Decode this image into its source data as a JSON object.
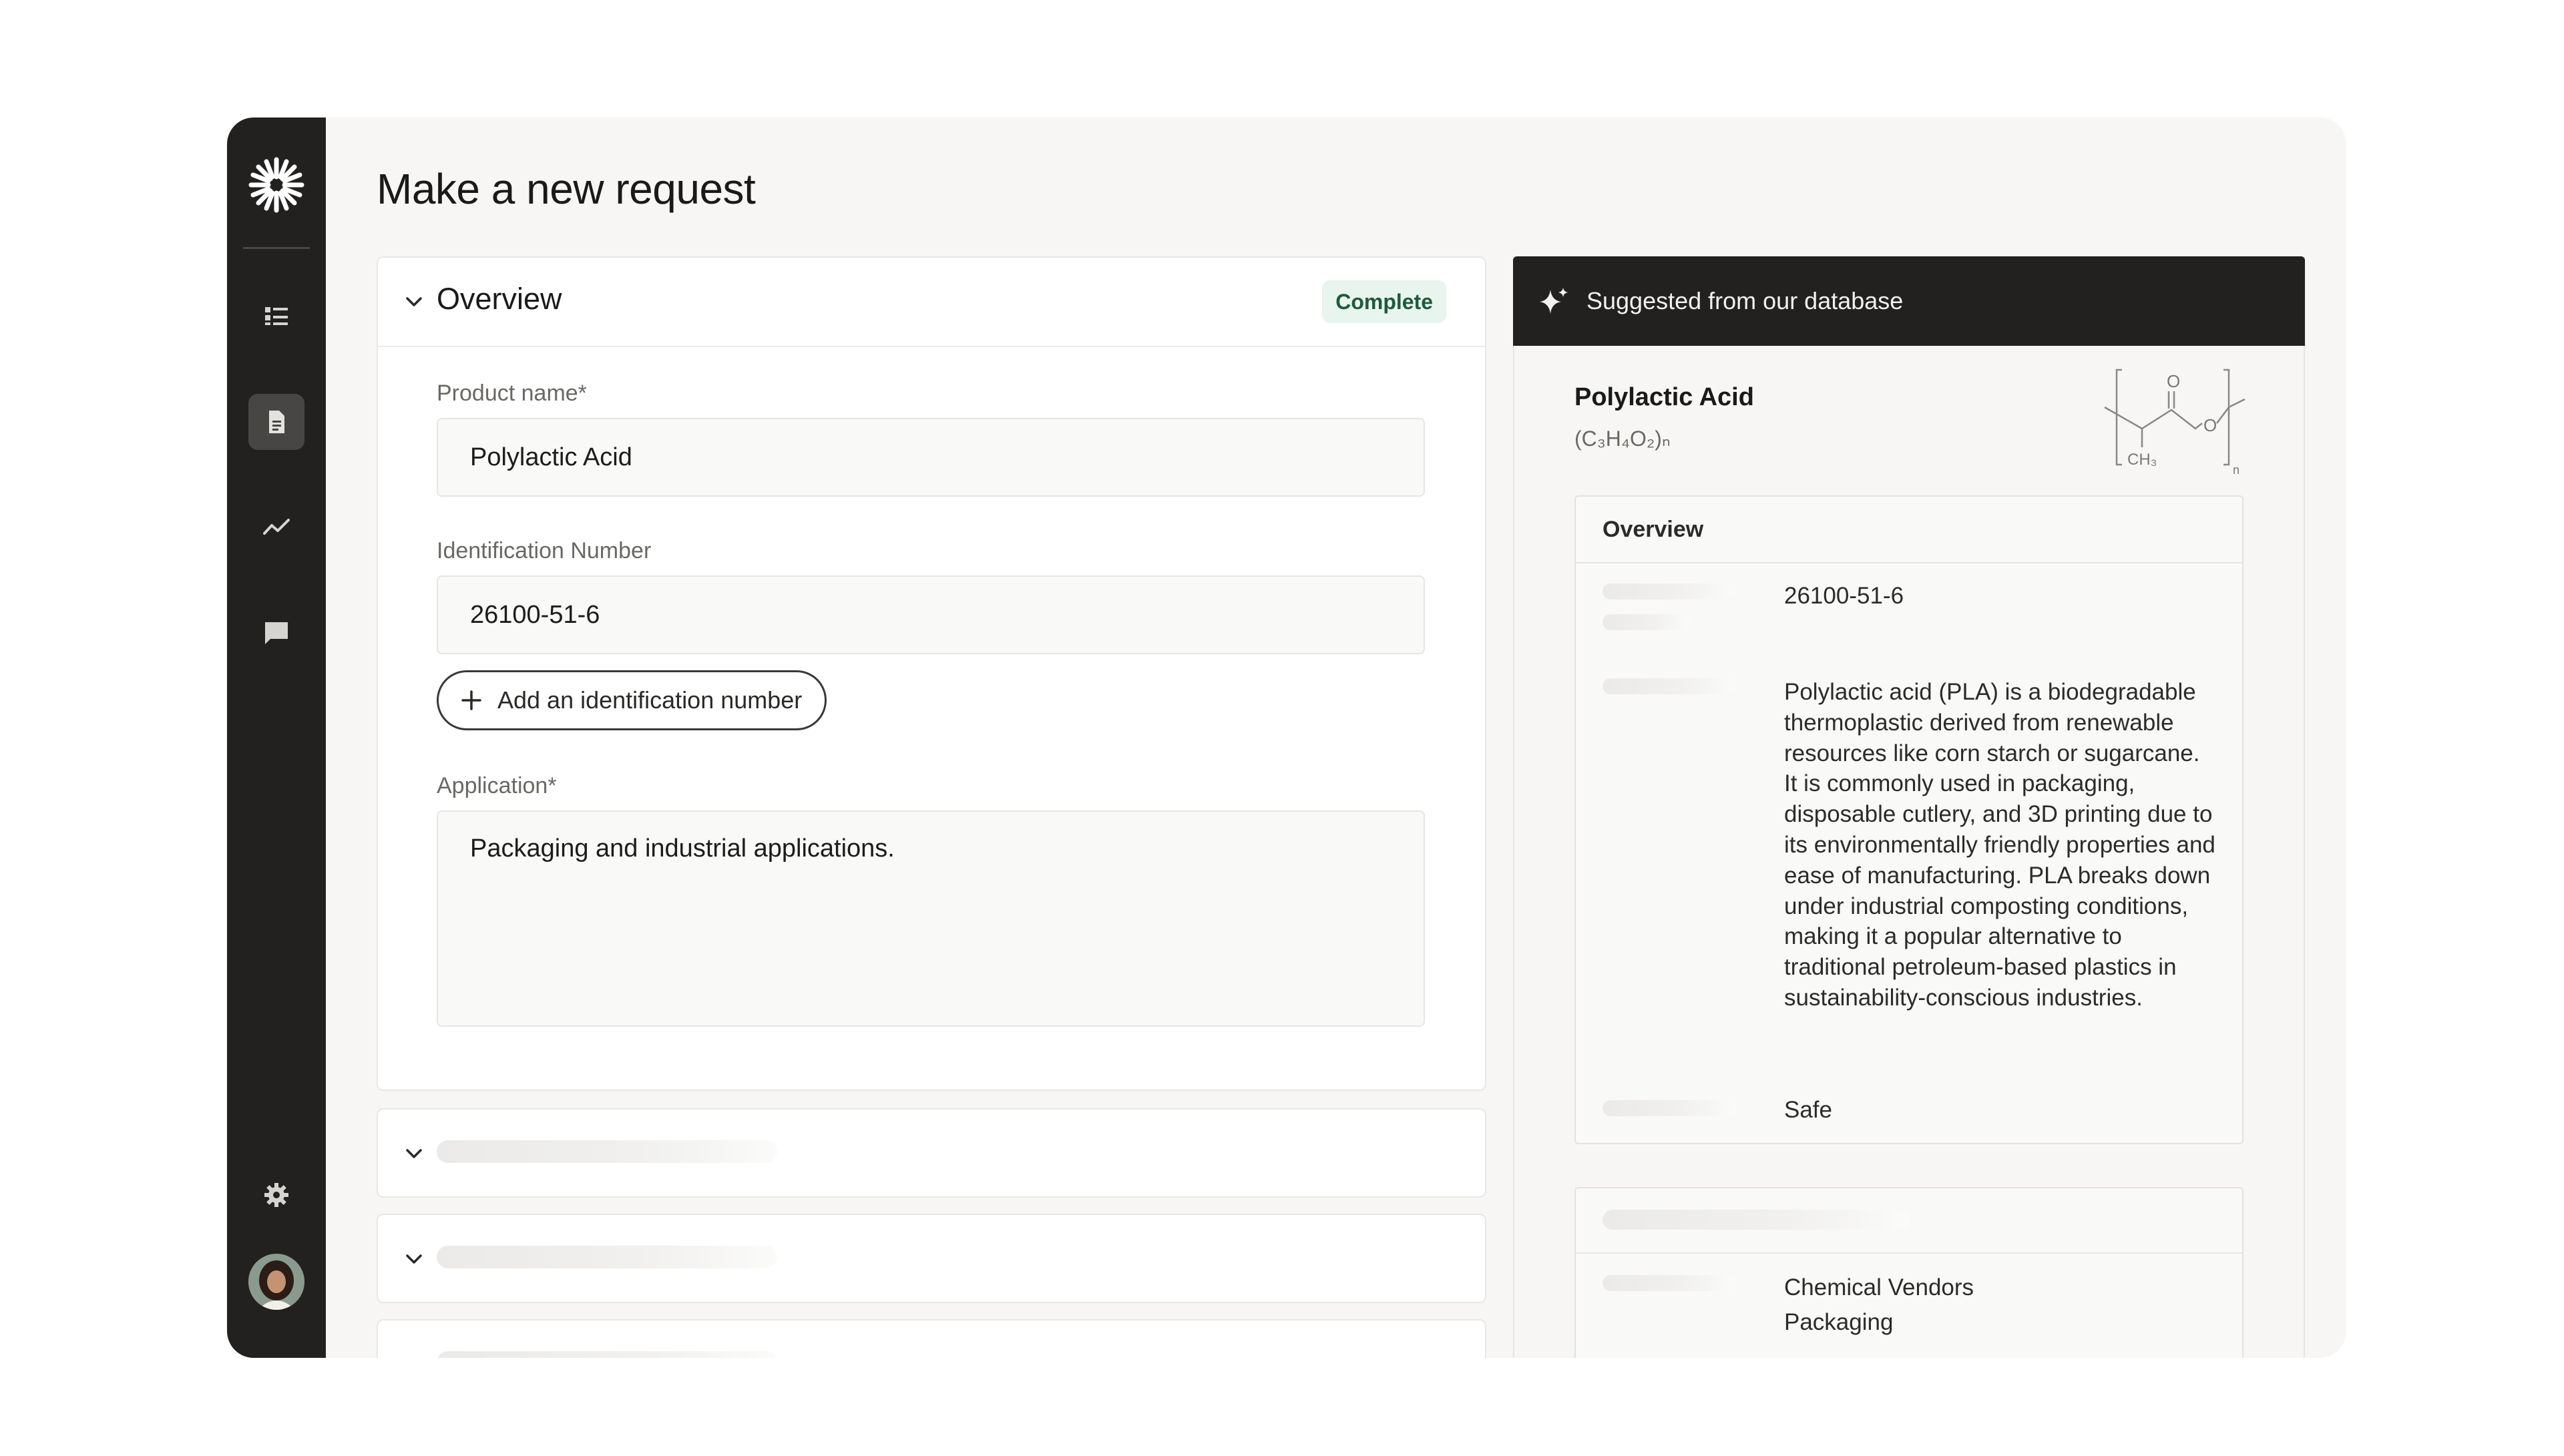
{
  "page": {
    "title": "Make a new request"
  },
  "sidebar": {
    "items": [
      {
        "icon": "list-icon",
        "active": false
      },
      {
        "icon": "document-icon",
        "active": true
      },
      {
        "icon": "trend-icon",
        "active": false
      },
      {
        "icon": "chat-icon",
        "active": false
      }
    ],
    "bottom": [
      {
        "icon": "gear-icon"
      },
      {
        "icon": "avatar"
      }
    ]
  },
  "overview": {
    "title": "Overview",
    "status": "Complete",
    "product_name": {
      "label": "Product name*",
      "value": "Polylactic Acid"
    },
    "identification": {
      "label": "Identification Number",
      "value": "26100-51-6"
    },
    "add_id_label": "Add an identification number",
    "application": {
      "label": "Application*",
      "value": "Packaging and industrial applications."
    }
  },
  "suggestion": {
    "header": "Suggested from our database",
    "product_name": "Polylactic Acid",
    "formula": "(C₃H₄O₂)ₙ",
    "structure_labels": {
      "o_top": "O",
      "o_side": "O",
      "methyl": "CH₃",
      "n": "n"
    },
    "overview_title": "Overview",
    "id_value": "26100-51-6",
    "description": "Polylactic acid (PLA) is a biodegradable thermoplastic derived from renewable resources like corn starch or sugarcane. It is commonly used in packaging, disposable cutlery, and 3D printing due to its environmentally friendly properties and ease of manufacturing. PLA breaks down under industrial composting conditions, making it a popular alternative to traditional petroleum-based plastics in sustainability-conscious industries.",
    "safety": "Safe",
    "vendors": [
      "Chemical Vendors",
      "Packaging"
    ]
  },
  "colors": {
    "sidebar": "#222120",
    "panel_header": "#23211f",
    "badge_bg": "#e8f4ee",
    "badge_text": "#1f5a3a"
  }
}
